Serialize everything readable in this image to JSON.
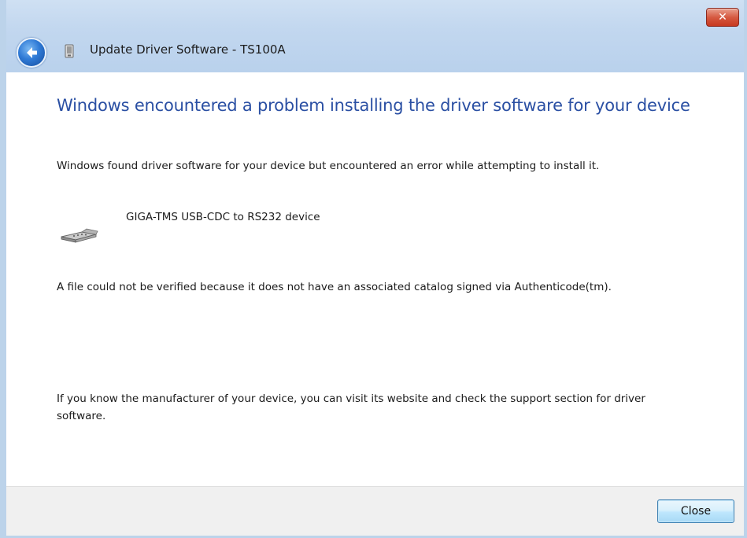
{
  "window": {
    "title": "Update Driver Software - TS100A",
    "close_glyph": "✕"
  },
  "main": {
    "heading": "Windows encountered a problem installing the driver software for your device",
    "intro": "Windows found driver software for your device but encountered an error while attempting to install it.",
    "device_name": "GIGA-TMS USB-CDC to RS232 device",
    "device_icon": "serial-port-icon",
    "error_message": "A file could not be verified because it does not have an associated catalog signed via Authenticode(tm).",
    "help_text": "If you know the manufacturer of your device, you can visit its website and check the support section for driver software."
  },
  "footer": {
    "close_label": "Close"
  },
  "colors": {
    "heading": "#2a4fa3",
    "titlebar": "#c2d7ef",
    "footer": "#f0f0f0",
    "close_x": "#c7381f"
  }
}
